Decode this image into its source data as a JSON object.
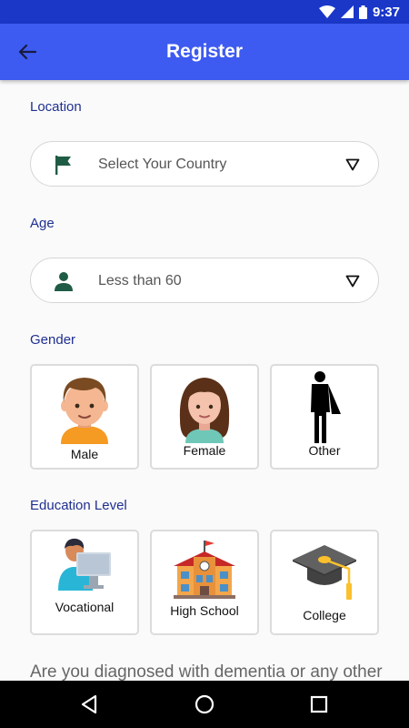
{
  "status_bar": {
    "time": "9:37"
  },
  "app_bar": {
    "title": "Register"
  },
  "location": {
    "label": "Location",
    "value": "Select Your Country"
  },
  "age": {
    "label": "Age",
    "value": "Less than 60"
  },
  "gender": {
    "label": "Gender",
    "options": [
      {
        "label": "Male",
        "icon": "male-avatar-icon"
      },
      {
        "label": "Female",
        "icon": "female-avatar-icon"
      },
      {
        "label": "Other",
        "icon": "other-gender-icon"
      }
    ]
  },
  "education": {
    "label": "Education Level",
    "options": [
      {
        "label": "Vocational",
        "icon": "vocational-icon"
      },
      {
        "label": "High School",
        "icon": "school-building-icon"
      },
      {
        "label": "College",
        "icon": "graduation-cap-icon"
      }
    ]
  },
  "question": {
    "text": "Are you diagnosed with dementia or any other"
  },
  "colors": {
    "primary": "#3d5bf0",
    "status_bar": "#1a37c8",
    "label_text": "#1f2f8f",
    "icon_green": "#1f5c45"
  }
}
